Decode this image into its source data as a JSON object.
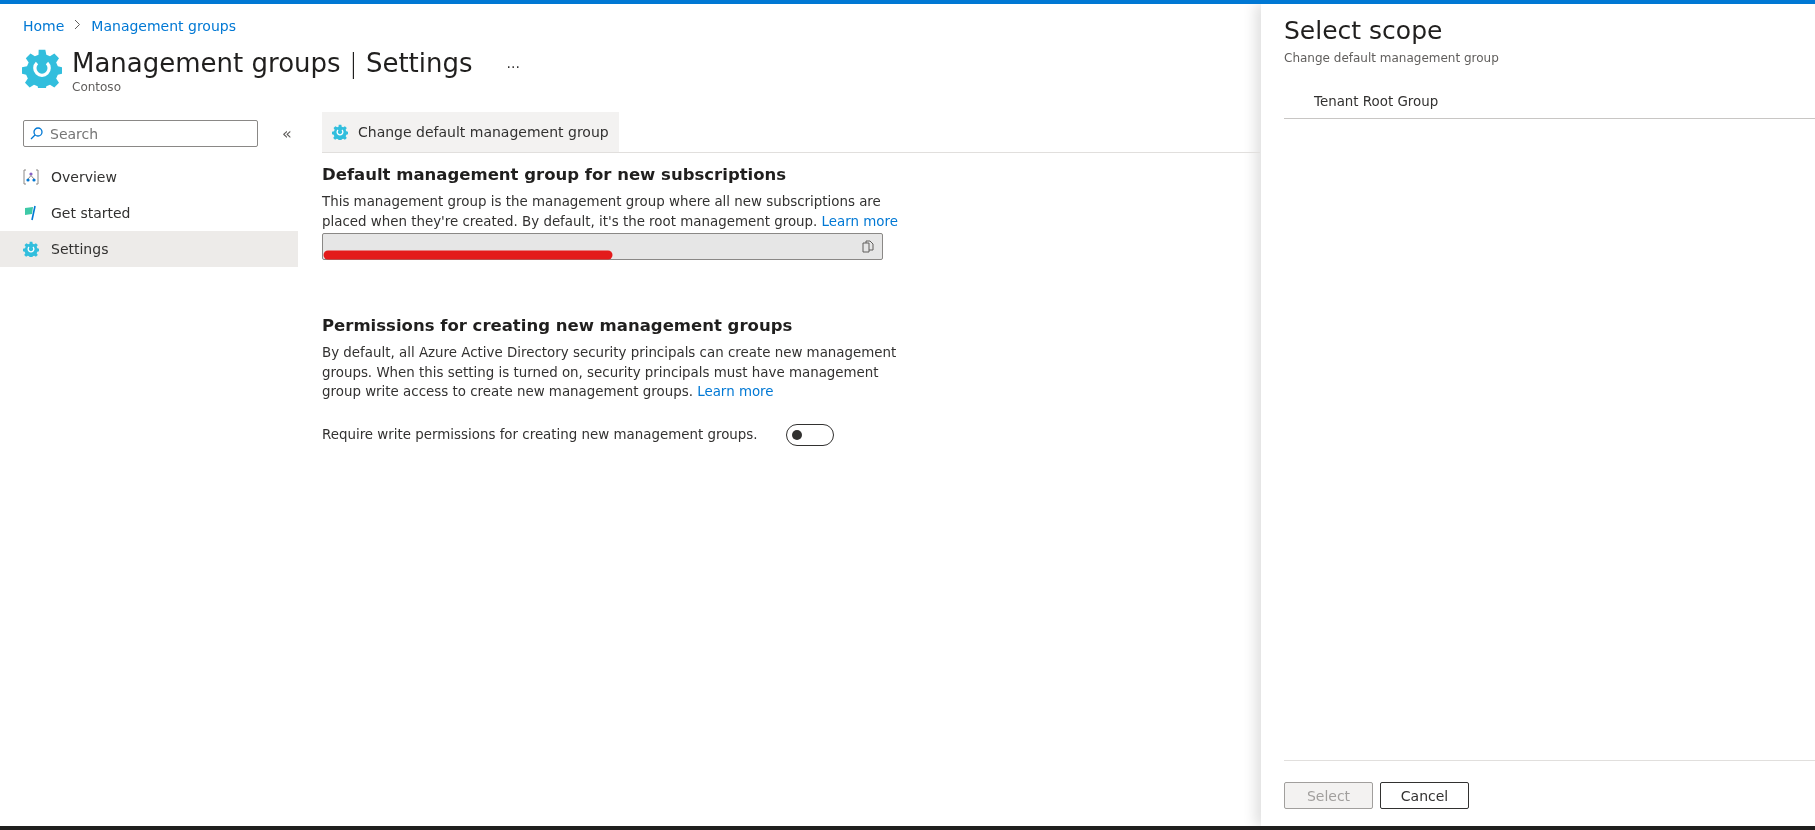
{
  "breadcrumb": [
    {
      "label": "Home"
    },
    {
      "label": "Management groups"
    }
  ],
  "header": {
    "title": "Management groups",
    "separator": "|",
    "subtitle_part": "Settings",
    "more": "···",
    "org": "Contoso"
  },
  "sidebar": {
    "search": {
      "placeholder": "Search"
    },
    "collapse": "«",
    "items": [
      {
        "label": "Overview",
        "kind": "overview",
        "selected": false
      },
      {
        "label": "Get started",
        "kind": "start",
        "selected": false
      },
      {
        "label": "Settings",
        "kind": "settings",
        "selected": true
      }
    ]
  },
  "toolbar": {
    "buttons": [
      {
        "label": "Change default management group"
      }
    ]
  },
  "sections": [
    {
      "heading": "Default management group for new subscriptions",
      "text": "This management group is the management group where all new subscriptions are placed when they're created. By default, it's the root management group.",
      "link": "Learn more",
      "kind": "field",
      "redacted": true
    },
    {
      "heading": "Permissions for creating new management groups",
      "text": "By default, all Azure Active Directory security principals can create new management groups. When this setting is turned on, security principals must have management group write access to create new management groups.",
      "link": "Learn more",
      "kind": "toggle",
      "toggle": {
        "label": "Require write permissions for creating new management groups.",
        "on": false
      }
    }
  ],
  "panel": {
    "title": "Select scope",
    "subtitle": "Change default management group",
    "items": [
      {
        "label": "Tenant Root Group"
      }
    ],
    "buttons": [
      {
        "label": "Select",
        "disabled": true
      },
      {
        "label": "Cancel",
        "disabled": false
      }
    ]
  }
}
